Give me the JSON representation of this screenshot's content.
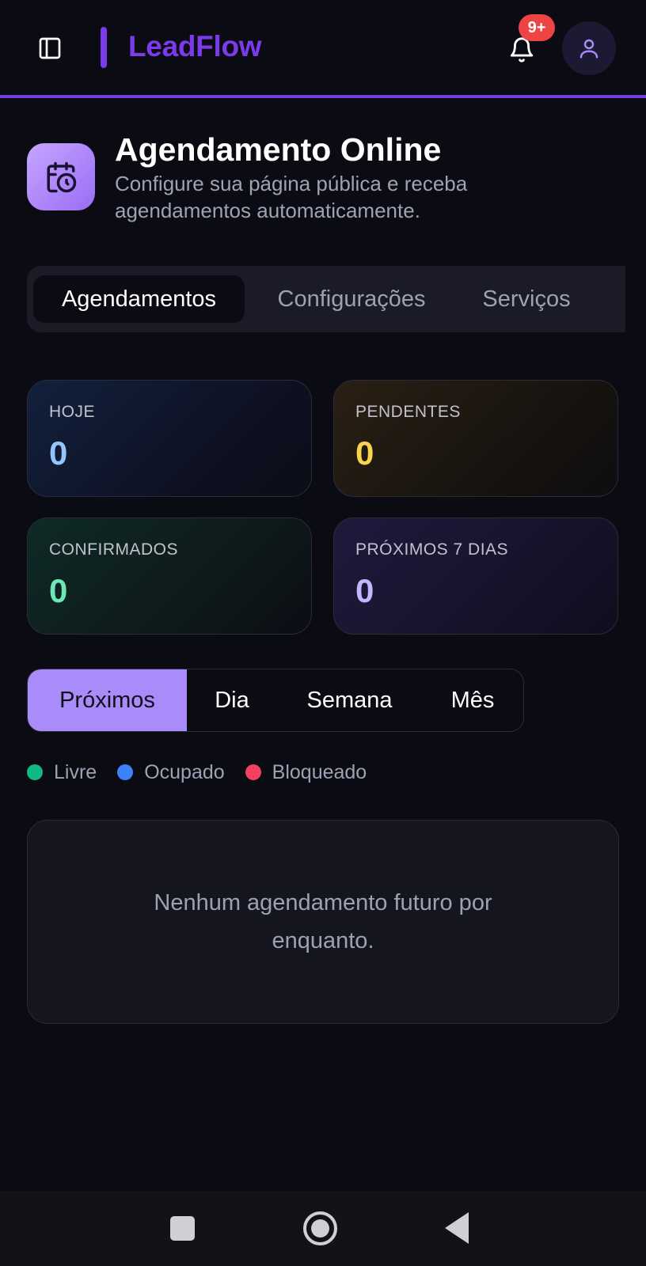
{
  "header": {
    "brand": "LeadFlow",
    "notifications_badge": "9+"
  },
  "page": {
    "title": "Agendamento Online",
    "subtitle": "Configure sua página pública e receba agendamentos automaticamente."
  },
  "main_tabs": [
    {
      "label": "Agendamentos",
      "active": true
    },
    {
      "label": "Configurações",
      "active": false
    },
    {
      "label": "Serviços",
      "active": false
    }
  ],
  "stats": {
    "hoje": {
      "label": "HOJE",
      "value": "0",
      "color": "#93c5fd"
    },
    "pendentes": {
      "label": "PENDENTES",
      "value": "0",
      "color": "#fcd34d"
    },
    "confirmados": {
      "label": "CONFIRMADOS",
      "value": "0",
      "color": "#6ee7b7"
    },
    "proximos": {
      "label": "PRÓXIMOS 7 DIAS",
      "value": "0",
      "color": "#c4b5fd"
    }
  },
  "view_tabs": [
    {
      "label": "Próximos",
      "active": true
    },
    {
      "label": "Dia",
      "active": false
    },
    {
      "label": "Semana",
      "active": false
    },
    {
      "label": "Mês",
      "active": false
    }
  ],
  "legend": [
    {
      "label": "Livre",
      "color": "#10b981"
    },
    {
      "label": "Ocupado",
      "color": "#3b82f6"
    },
    {
      "label": "Bloqueado",
      "color": "#f43f5e"
    }
  ],
  "empty_state": {
    "message": "Nenhum agendamento futuro por enquanto."
  },
  "icons": {
    "sidebar_toggle": "sidebar-toggle-icon",
    "bell": "bell-icon",
    "user": "user-icon",
    "calendar_clock": "calendar-clock-icon"
  },
  "colors": {
    "accent": "#7c3aed",
    "accent_light": "#a98bf9",
    "badge": "#ef4444",
    "background": "#0b0b14"
  }
}
